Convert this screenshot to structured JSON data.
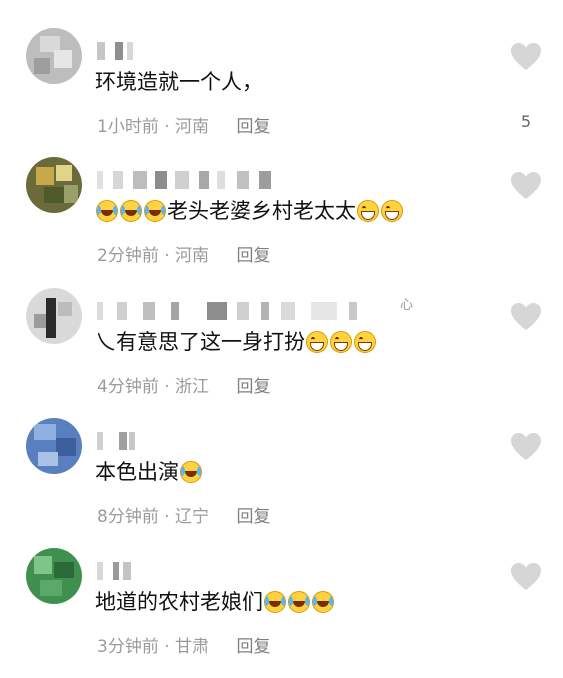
{
  "comments": [
    {
      "text": "环境造就一个人，",
      "time": "1小时前",
      "sep": "·",
      "location": "河南",
      "reply": "回复",
      "like_count": "5",
      "emojis_after": []
    },
    {
      "text": "老头老婆乡村老太太",
      "time": "2分钟前",
      "sep": "·",
      "location": "河南",
      "reply": "回复",
      "like_count": "",
      "emojis_before": [
        "cry",
        "cry",
        "cry"
      ],
      "emojis_after": [
        "laugh",
        "laugh"
      ]
    },
    {
      "text": "乀有意思了这一身打扮",
      "time": "4分钟前",
      "sep": "·",
      "location": "浙江",
      "reply": "回复",
      "like_count": "",
      "name_suffix": "心",
      "emojis_after": [
        "laugh",
        "laugh",
        "laugh"
      ]
    },
    {
      "text": "本色出演",
      "time": "8分钟前",
      "sep": "·",
      "location": "辽宁",
      "reply": "回复",
      "like_count": "",
      "emojis_after": [
        "cry"
      ]
    },
    {
      "text": "地道的农村老娘们",
      "time": "3分钟前",
      "sep": "·",
      "location": "甘肃",
      "reply": "回复",
      "like_count": "",
      "emojis_after": [
        "cry",
        "cry",
        "cry"
      ]
    }
  ],
  "icons": {
    "like": "heart-icon",
    "avatar": "avatar-pixelated"
  },
  "colors": {
    "meta": "#9b9b9b",
    "heart": "#d6d6d6",
    "text": "#111111"
  }
}
